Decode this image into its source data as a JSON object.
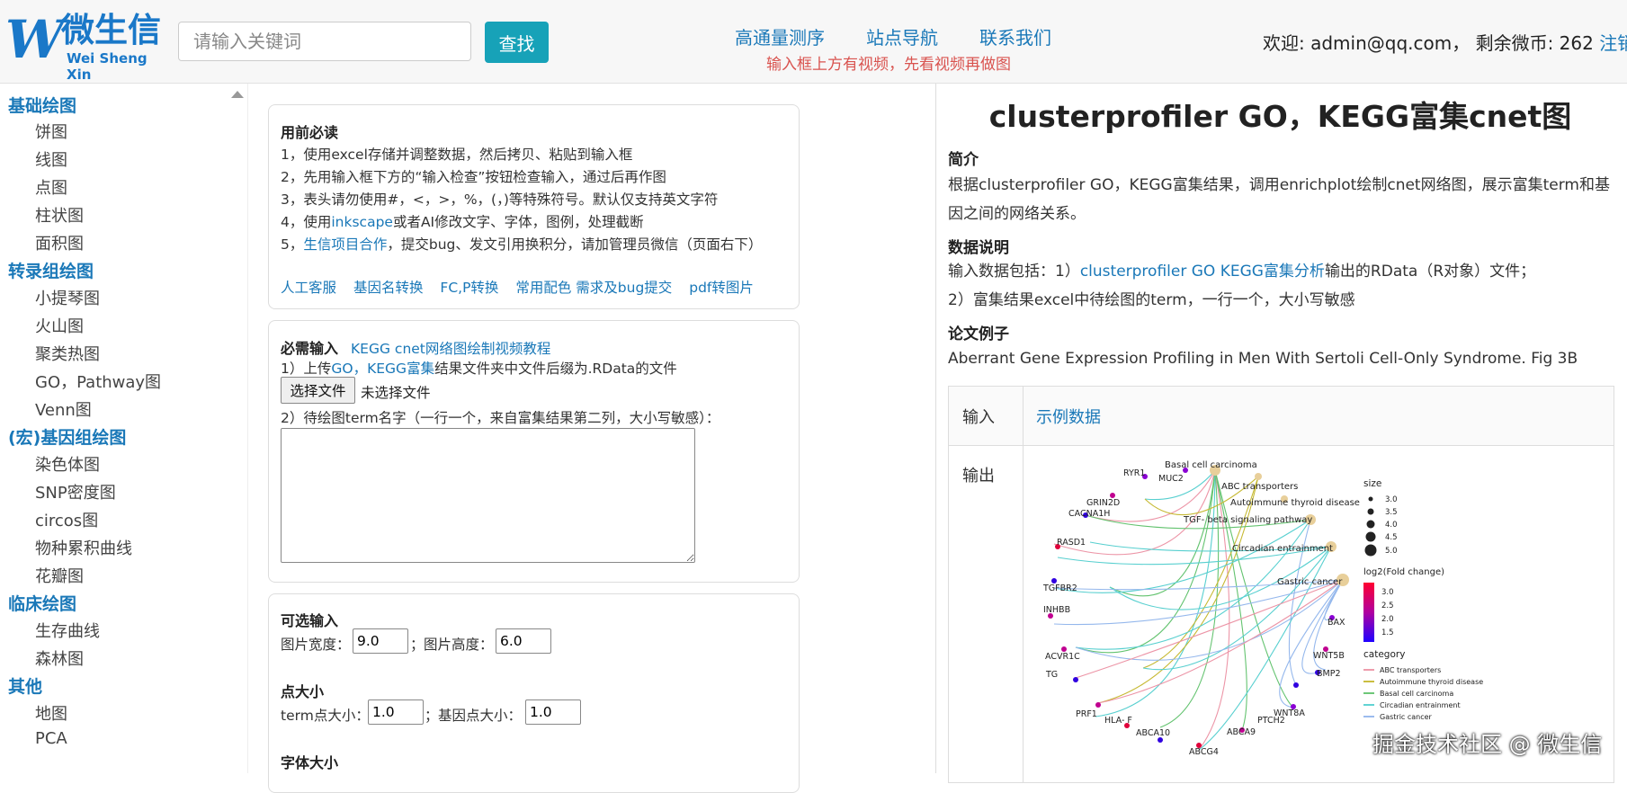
{
  "header": {
    "logo": {
      "mark": "W",
      "name_cn": "微生信",
      "name_en": "Wei Sheng Xin"
    },
    "search": {
      "placeholder": "请输入关键词",
      "button": "查找"
    },
    "nav": [
      "高通量测序",
      "站点导航",
      "联系我们"
    ],
    "notice": "输入框上方有视频，先看视频再做图",
    "user": {
      "welcome": "欢迎: admin@qq.com，  剩余微币: 262",
      "logout": "注销"
    }
  },
  "sidebar": {
    "categories": [
      {
        "title": "基础绘图",
        "items": [
          "饼图",
          "线图",
          "点图",
          "柱状图",
          "面积图"
        ]
      },
      {
        "title": "转录组绘图",
        "items": [
          "小提琴图",
          "火山图",
          "聚类热图",
          "GO，Pathway图",
          "Venn图"
        ]
      },
      {
        "title": "(宏)基因组绘图",
        "items": [
          "染色体图",
          "SNP密度图",
          "circos图",
          "物种累积曲线",
          "花瓣图"
        ]
      },
      {
        "title": "临床绘图",
        "items": [
          "生存曲线",
          "森林图"
        ]
      },
      {
        "title": "其他",
        "items": [
          "地图",
          "PCA"
        ]
      }
    ]
  },
  "notes": {
    "title": "用前必读",
    "lines": [
      "1，使用excel存储并调整数据，然后拷贝、粘贴到输入框",
      "2，先用输入框下方的“输入检查”按钮检查输入，通过后再作图",
      "3，表头请勿使用#，<，>，%，(，)等特殊符号。默认仅支持英文字符"
    ],
    "line4": {
      "pre": "4，使用",
      "link": "inkscape",
      "post": "或者AI修改文字、字体，图例，处理截断"
    },
    "line5": {
      "pre": "5，",
      "link": "生信项目合作",
      "post": "，提交bug、发文引用换积分，请加管理员微信（页面右下）"
    },
    "links": [
      "人工客服",
      "基因名转换",
      "FC,P转换",
      "常用配色 需求及bug提交",
      "pdf转图片"
    ]
  },
  "required": {
    "title": "必需输入",
    "video_link": "KEGG cnet网络图绘制视频教程",
    "upload": {
      "pre": "1）上传",
      "link": "GO，KEGG富集",
      "post": "结果文件夹中文件后缀为.RData的文件"
    },
    "file_button": "选择文件",
    "file_status": "未选择文件",
    "term_label": "2）待绘图term名字（一行一个，来自富集结果第二列，大小写敏感）："
  },
  "optional": {
    "title": "可选输入",
    "width_label": "图片宽度：",
    "width_value": "9.0",
    "sep": "；",
    "height_label": "图片高度：",
    "height_value": "6.0",
    "point_title": "点大小",
    "term_point_label": "term点大小：",
    "term_point_value": "1.0",
    "gene_point_label": "基因点大小：",
    "gene_point_value": "1.0",
    "font_title": "字体大小"
  },
  "detail": {
    "title": "clusterprofiler GO，KEGG富集cnet图",
    "intro_h": "简介",
    "intro_1": "根据clusterprofiler GO，KEGG富集结果，调用enrichplot绘制cnet网络图，展示富集term和基",
    "intro_2": "因之间的网络关系。",
    "data_h": "数据说明",
    "data_1_pre": "输入数据包括：1）",
    "data_1_link": "clusterprofiler GO KEGG富集分析",
    "data_1_post": "输出的RData（R对象）文件；",
    "data_2": "2）富集结果excel中待绘图的term，一行一个，大小写敏感",
    "paper_h": "论文例子",
    "paper_link": "Aberrant Gene Expression Profiling in Men With Sertoli Cell-Only Syndrome. Fig 3B",
    "table": {
      "input_label": "输入",
      "input_value": "示例数据",
      "output_label": "输出"
    }
  },
  "plot": {
    "terms": [
      "Basal cell carcinoma",
      "ABC transporters",
      "Autoimmune thyroid disease",
      "TGF- beta signaling pathway",
      "Circadian entrainment",
      "Gastric cancer"
    ],
    "genes": [
      "RYR1",
      "MUC2",
      "GRIN2D",
      "CACNA1H",
      "RASD1",
      "TGFBR2",
      "INHBB",
      "ACVR1C",
      "TG",
      "PRF1",
      "HLA- F",
      "ABCA10",
      "ABCG4",
      "ABCA9",
      "PTCH2",
      "WNT8A",
      "BMP2",
      "WNT5B",
      "BAX"
    ],
    "legend_size_title": "size",
    "size_values": [
      "3.0",
      "3.5",
      "4.0",
      "4.5",
      "5.0"
    ],
    "legend_fc_title": "log2(Fold change)",
    "fc_values": [
      "3.0",
      "2.5",
      "2.0",
      "1.5"
    ],
    "legend_cat_title": "category",
    "categories": [
      "ABC transporters",
      "Autoimmune thyroid disease",
      "Basal cell carcinoma",
      "Circadian entrainment",
      "Gastric cancer"
    ],
    "category_colors": [
      "#e87a90",
      "#b8a800",
      "#3cb44b",
      "#2ec4c4",
      "#7aa6e8"
    ]
  },
  "watermark": "掘金技术社区 @ 微生信"
}
